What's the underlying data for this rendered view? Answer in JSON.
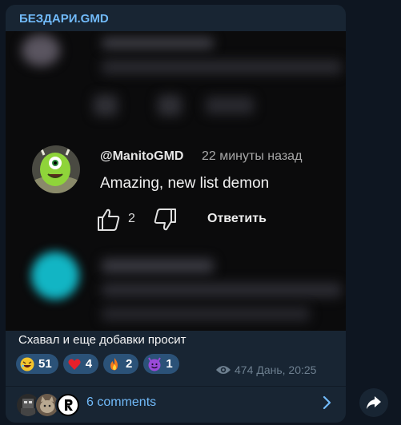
{
  "post": {
    "channel_name": "БЕЗДАРИ.GMD",
    "caption": "Схавал и еще добавки просит",
    "views": "474",
    "timestamp": "Дань, 20:25"
  },
  "comment": {
    "author": "@ManitoGMD",
    "time": "22 минуты назад",
    "text": "Amazing, new list demon",
    "like_count": "2",
    "reply_label": "Ответить"
  },
  "reactions": [
    {
      "emoji": "rolling-laughing-emoji",
      "count": "51"
    },
    {
      "emoji": "red-heart-emoji",
      "count": "4"
    },
    {
      "emoji": "fire-emoji",
      "count": "2"
    },
    {
      "emoji": "smiling-devil-emoji",
      "count": "1"
    }
  ],
  "comments_link": "6 comments",
  "colors": {
    "background": "#0e1621",
    "bubble": "#182533",
    "accent": "#71baf9",
    "reaction_chip": "#2b5278"
  }
}
